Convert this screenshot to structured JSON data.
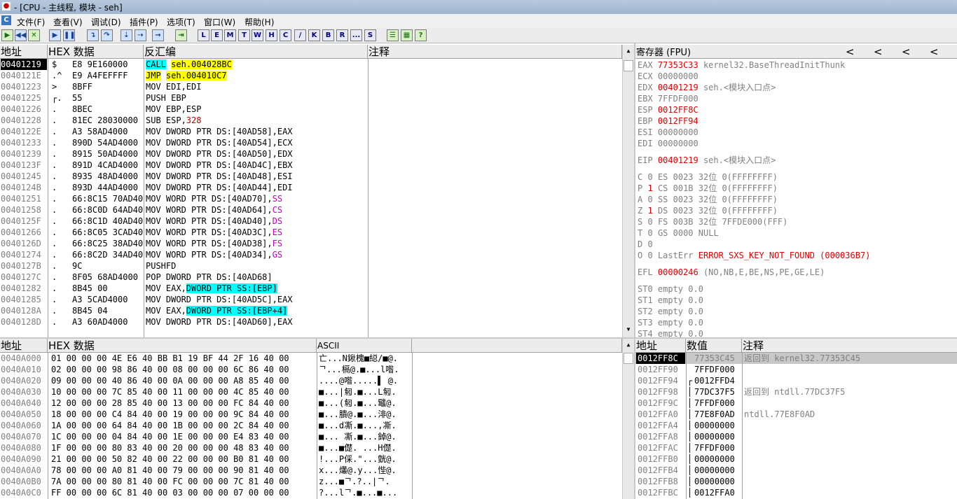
{
  "window": {
    "title": "- [CPU - 主线程, 模块 - seh]",
    "icon": "app-icon"
  },
  "menu": [
    "文件(F)",
    "查看(V)",
    "调试(D)",
    "插件(P)",
    "选项(T)",
    "窗口(W)",
    "帮助(H)"
  ],
  "toolbar": {
    "buttons": [
      "open",
      "restart",
      "close",
      "run",
      "pause",
      "step-into",
      "step-over",
      "trace-into",
      "trace-over",
      "execute-till-return",
      "go-to"
    ],
    "letters": [
      "L",
      "E",
      "M",
      "T",
      "W",
      "H",
      "C",
      "/",
      "K",
      "B",
      "R",
      "...",
      "S"
    ],
    "extra": [
      "list",
      "grid",
      "help"
    ]
  },
  "disasm": {
    "headers": [
      "地址",
      "HEX 数据",
      "反汇编",
      "注释"
    ],
    "rows": [
      {
        "addr": "00401219",
        "mark": "$",
        "hex": "E8 9E160000",
        "asm": "CALL",
        "arg": "seh.004028BC",
        "style": "call",
        "selected": true
      },
      {
        "addr": "0040121E",
        "mark": ".^",
        "hex": "E9 A4FEFFFF",
        "asm": "JMP",
        "arg": "seh.004010C7",
        "style": "jmp"
      },
      {
        "addr": "00401223",
        "mark": ">",
        "hex": "8BFF",
        "asm": "MOV EDI,EDI"
      },
      {
        "addr": "00401225",
        "mark": "┌.",
        "hex": "55",
        "asm": "PUSH EBP"
      },
      {
        "addr": "00401226",
        "mark": ".",
        "hex": "8BEC",
        "asm": "MOV EBP,ESP"
      },
      {
        "addr": "00401228",
        "mark": ".",
        "hex": "81EC 28030000",
        "asm": "SUB ESP,",
        "num": "328"
      },
      {
        "addr": "0040122E",
        "mark": ".",
        "hex": "A3 58AD4000",
        "asm": "MOV DWORD PTR DS:[40AD58],EAX"
      },
      {
        "addr": "00401233",
        "mark": ".",
        "hex": "890D 54AD4000",
        "asm": "MOV DWORD PTR DS:[40AD54],ECX"
      },
      {
        "addr": "00401239",
        "mark": ".",
        "hex": "8915 50AD4000",
        "asm": "MOV DWORD PTR DS:[40AD50],EDX"
      },
      {
        "addr": "0040123F",
        "mark": ".",
        "hex": "891D 4CAD4000",
        "asm": "MOV DWORD PTR DS:[40AD4C],EBX"
      },
      {
        "addr": "00401245",
        "mark": ".",
        "hex": "8935 48AD4000",
        "asm": "MOV DWORD PTR DS:[40AD48],ESI"
      },
      {
        "addr": "0040124B",
        "mark": ".",
        "hex": "893D 44AD4000",
        "asm": "MOV DWORD PTR DS:[40AD44],EDI"
      },
      {
        "addr": "00401251",
        "mark": ".",
        "hex": "66:8C15 70AD4000",
        "asm": "MOV WORD PTR DS:[40AD70],",
        "seg": "SS"
      },
      {
        "addr": "00401258",
        "mark": ".",
        "hex": "66:8C0D 64AD4000",
        "asm": "MOV WORD PTR DS:[40AD64],",
        "seg": "CS"
      },
      {
        "addr": "0040125F",
        "mark": ".",
        "hex": "66:8C1D 40AD4000",
        "asm": "MOV WORD PTR DS:[40AD40],",
        "seg": "DS"
      },
      {
        "addr": "00401266",
        "mark": ".",
        "hex": "66:8C05 3CAD4000",
        "asm": "MOV WORD PTR DS:[40AD3C],",
        "seg": "ES"
      },
      {
        "addr": "0040126D",
        "mark": ".",
        "hex": "66:8C25 38AD4000",
        "asm": "MOV WORD PTR DS:[40AD38],",
        "seg": "FS"
      },
      {
        "addr": "00401274",
        "mark": ".",
        "hex": "66:8C2D 34AD4000",
        "asm": "MOV WORD PTR DS:[40AD34],",
        "seg": "GS"
      },
      {
        "addr": "0040127B",
        "mark": ".",
        "hex": "9C",
        "asm": "PUSHFD"
      },
      {
        "addr": "0040127C",
        "mark": ".",
        "hex": "8F05 68AD4000",
        "asm": "POP DWORD PTR DS:[40AD68]"
      },
      {
        "addr": "00401282",
        "mark": ".",
        "hex": "8B45 00",
        "asm": "MOV EAX,",
        "stack": "DWORD PTR SS:[EBP]"
      },
      {
        "addr": "00401285",
        "mark": ".",
        "hex": "A3 5CAD4000",
        "asm": "MOV DWORD PTR DS:[40AD5C],EAX"
      },
      {
        "addr": "0040128A",
        "mark": ".",
        "hex": "8B45 04",
        "asm": "MOV EAX,",
        "stack": "DWORD PTR SS:[EBP+4]"
      },
      {
        "addr": "0040128D",
        "mark": ".",
        "hex": "A3 60AD4000",
        "asm": "MOV DWORD PTR DS:[40AD60],EAX"
      }
    ]
  },
  "registers": {
    "title": "寄存器 (FPU)",
    "arrows": [
      "<",
      "<",
      "<",
      "<"
    ],
    "lines": [
      {
        "name": "EAX",
        "val": "77353C33",
        "red": true,
        "cmt": "kernel32.BaseThreadInitThunk"
      },
      {
        "name": "ECX",
        "val": "00000000",
        "red": false,
        "cmt": ""
      },
      {
        "name": "EDX",
        "val": "00401219",
        "red": true,
        "cmt": "seh.<模块入口点>"
      },
      {
        "name": "EBX",
        "val": "7FFDF000",
        "red": false,
        "cmt": ""
      },
      {
        "name": "ESP",
        "val": "0012FF8C",
        "red": true,
        "cmt": ""
      },
      {
        "name": "EBP",
        "val": "0012FF94",
        "red": true,
        "cmt": ""
      },
      {
        "name": "ESI",
        "val": "00000000",
        "red": false,
        "cmt": ""
      },
      {
        "name": "EDI",
        "val": "00000000",
        "red": false,
        "cmt": ""
      }
    ],
    "eip": {
      "name": "EIP",
      "val": "00401219",
      "cmt": "seh.<模块入口点>"
    },
    "flags": [
      {
        "f": "C",
        "v": "0",
        "seg": "ES",
        "sv": "0023",
        "bits": "32位",
        "info": "0(FFFFFFFF)",
        "red": false
      },
      {
        "f": "P",
        "v": "1",
        "seg": "CS",
        "sv": "001B",
        "bits": "32位",
        "info": "0(FFFFFFFF)",
        "red": true
      },
      {
        "f": "A",
        "v": "0",
        "seg": "SS",
        "sv": "0023",
        "bits": "32位",
        "info": "0(FFFFFFFF)",
        "red": false
      },
      {
        "f": "Z",
        "v": "1",
        "seg": "DS",
        "sv": "0023",
        "bits": "32位",
        "info": "0(FFFFFFFF)",
        "red": true
      },
      {
        "f": "S",
        "v": "0",
        "seg": "FS",
        "sv": "003B",
        "bits": "32位",
        "info": "7FFDE000(FFF)",
        "red": false
      },
      {
        "f": "T",
        "v": "0",
        "seg": "GS",
        "sv": "0000",
        "bits": "",
        "info": "NULL",
        "red": false
      },
      {
        "f": "D",
        "v": "0",
        "seg": "",
        "sv": "",
        "bits": "",
        "info": "",
        "red": false
      }
    ],
    "lasterr": {
      "f": "O",
      "v": "0",
      "label": "LastErr",
      "err": "ERROR_SXS_KEY_NOT_FOUND (000036B7)"
    },
    "efl": {
      "name": "EFL",
      "val": "00000246",
      "desc": "(NO,NB,E,BE,NS,PE,GE,LE)"
    },
    "st": [
      "ST0 empty 0.0",
      "ST1 empty 0.0",
      "ST2 empty 0.0",
      "ST3 empty 0.0",
      "ST4 empty 0.0"
    ]
  },
  "dump": {
    "headers": [
      "地址",
      "HEX 数据",
      "ASCII"
    ],
    "rows": [
      {
        "addr": "0040A000",
        "hex": "01 00 00 00 4E E6 40 BB B1 19 BF 44 2F 16 40 00",
        "ascii": "亡...N鍬槐■縂/■@."
      },
      {
        "addr": "0040A010",
        "hex": "02 00 00 00 98 86 40 00 08 00 00 00 6C 86 40 00",
        "ascii": "ᄀ...槅@.■...l喒."
      },
      {
        "addr": "0040A020",
        "hex": "09 00 00 00 40 86 40 00 0A 00 00 00 A8 85 40 00",
        "ascii": "....@喒.....▌ @."
      },
      {
        "addr": "0040A030",
        "hex": "10 00 00 00 7C 85 40 00 11 00 00 00 4C 85 40 00",
        "ascii": "■...|匑.■...L匑."
      },
      {
        "addr": "0040A040",
        "hex": "12 00 00 00 28 85 40 00 13 00 00 00 FC 84 40 00",
        "ascii": "■...(匑.■...鼊@."
      },
      {
        "addr": "0040A050",
        "hex": "18 00 00 00 C4 84 40 00 19 00 00 00 9C 84 40 00",
        "ascii": "■...膭@.■...渄@."
      },
      {
        "addr": "0040A060",
        "hex": "1A 00 00 00 64 84 40 00 1B 00 00 00 2C 84 40 00",
        "ascii": "■...d凘.■...,凘."
      },
      {
        "addr": "0040A070",
        "hex": "1C 00 00 00 04 84 40 00 1E 00 00 00 E4 83 40 00",
        "ascii": "■... 凘.■...鋽@."
      },
      {
        "addr": "0040A080",
        "hex": "1F 00 00 00 80 83 40 00 20 00 00 00 48 83 40 00",
        "ascii": "■...■儊. ...H儊."
      },
      {
        "addr": "0040A090",
        "hex": "21 00 00 00 50 82 40 00 22 00 00 00 B0 81 40 00",
        "ascii": "!...P倸.\"...皝@."
      },
      {
        "addr": "0040A0A0",
        "hex": "78 00 00 00 A0 81 40 00 79 00 00 00 90 81 40 00",
        "ascii": "x...爜@.y...悂@."
      },
      {
        "addr": "0040A0B0",
        "hex": "7A 00 00 00 80 81 40 00 FC 00 00 00 7C 81 40 00",
        "ascii": "z...■ᄀ.?..|ᄀ."
      },
      {
        "addr": "0040A0C0",
        "hex": "FF 00 00 00 6C 81 40 00 03 00 00 00 07 00 00 00",
        "ascii": "?...lᄀ.■...■..."
      }
    ]
  },
  "stack": {
    "headers": [
      "地址",
      "数值",
      "注释"
    ],
    "rows": [
      {
        "addr": "0012FF8C",
        "val": "77353C45",
        "cmt": "返回到 kernel32.77353C45",
        "selected": true,
        "mark": ""
      },
      {
        "addr": "0012FF90",
        "val": "7FFDF000",
        "cmt": "",
        "mark": ""
      },
      {
        "addr": "0012FF94",
        "val": "0012FFD4",
        "cmt": "",
        "mark": "┌"
      },
      {
        "addr": "0012FF98",
        "val": "77DC37F5",
        "cmt": "返回到 ntdll.77DC37F5",
        "mark": "│"
      },
      {
        "addr": "0012FF9C",
        "val": "7FFDF000",
        "cmt": "",
        "mark": "│"
      },
      {
        "addr": "0012FFA0",
        "val": "77E8F0AD",
        "cmt": "ntdll.77E8F0AD",
        "mark": "│"
      },
      {
        "addr": "0012FFA4",
        "val": "00000000",
        "cmt": "",
        "mark": "│"
      },
      {
        "addr": "0012FFA8",
        "val": "00000000",
        "cmt": "",
        "mark": "│"
      },
      {
        "addr": "0012FFAC",
        "val": "7FFDF000",
        "cmt": "",
        "mark": "│"
      },
      {
        "addr": "0012FFB0",
        "val": "00000000",
        "cmt": "",
        "mark": "│"
      },
      {
        "addr": "0012FFB4",
        "val": "00000000",
        "cmt": "",
        "mark": "│"
      },
      {
        "addr": "0012FFB8",
        "val": "00000000",
        "cmt": "",
        "mark": "│"
      },
      {
        "addr": "0012FFBC",
        "val": "0012FFA0",
        "cmt": "",
        "mark": "│"
      }
    ]
  }
}
